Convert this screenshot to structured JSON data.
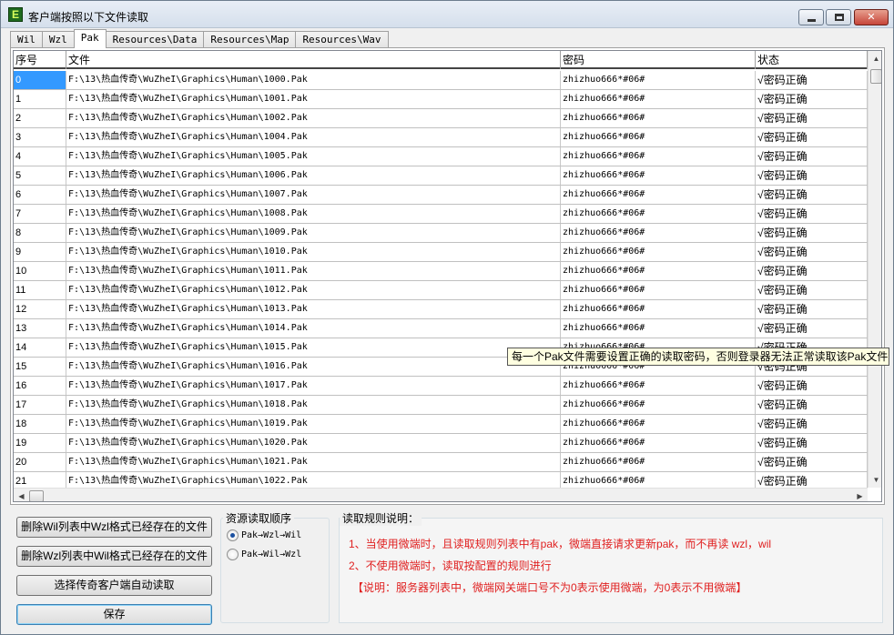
{
  "window": {
    "title": "客户端按照以下文件读取",
    "icon_letter": "E"
  },
  "tabs": [
    "Wil",
    "Wzl",
    "Pak",
    "Resources\\Data",
    "Resources\\Map",
    "Resources\\Wav"
  ],
  "active_tab": "Pak",
  "table": {
    "headers": [
      "序号",
      "文件",
      "密码",
      "状态"
    ],
    "rows": [
      {
        "idx": "0",
        "file": "F:\\13\\热血传奇\\WuZheI\\Graphics\\Human\\1000.Pak",
        "pwd": "zhizhuo666*#06#",
        "status": "√密码正确"
      },
      {
        "idx": "1",
        "file": "F:\\13\\热血传奇\\WuZheI\\Graphics\\Human\\1001.Pak",
        "pwd": "zhizhuo666*#06#",
        "status": "√密码正确"
      },
      {
        "idx": "2",
        "file": "F:\\13\\热血传奇\\WuZheI\\Graphics\\Human\\1002.Pak",
        "pwd": "zhizhuo666*#06#",
        "status": "√密码正确"
      },
      {
        "idx": "3",
        "file": "F:\\13\\热血传奇\\WuZheI\\Graphics\\Human\\1004.Pak",
        "pwd": "zhizhuo666*#06#",
        "status": "√密码正确"
      },
      {
        "idx": "4",
        "file": "F:\\13\\热血传奇\\WuZheI\\Graphics\\Human\\1005.Pak",
        "pwd": "zhizhuo666*#06#",
        "status": "√密码正确"
      },
      {
        "idx": "5",
        "file": "F:\\13\\热血传奇\\WuZheI\\Graphics\\Human\\1006.Pak",
        "pwd": "zhizhuo666*#06#",
        "status": "√密码正确"
      },
      {
        "idx": "6",
        "file": "F:\\13\\热血传奇\\WuZheI\\Graphics\\Human\\1007.Pak",
        "pwd": "zhizhuo666*#06#",
        "status": "√密码正确"
      },
      {
        "idx": "7",
        "file": "F:\\13\\热血传奇\\WuZheI\\Graphics\\Human\\1008.Pak",
        "pwd": "zhizhuo666*#06#",
        "status": "√密码正确"
      },
      {
        "idx": "8",
        "file": "F:\\13\\热血传奇\\WuZheI\\Graphics\\Human\\1009.Pak",
        "pwd": "zhizhuo666*#06#",
        "status": "√密码正确"
      },
      {
        "idx": "9",
        "file": "F:\\13\\热血传奇\\WuZheI\\Graphics\\Human\\1010.Pak",
        "pwd": "zhizhuo666*#06#",
        "status": "√密码正确"
      },
      {
        "idx": "10",
        "file": "F:\\13\\热血传奇\\WuZheI\\Graphics\\Human\\1011.Pak",
        "pwd": "zhizhuo666*#06#",
        "status": "√密码正确"
      },
      {
        "idx": "11",
        "file": "F:\\13\\热血传奇\\WuZheI\\Graphics\\Human\\1012.Pak",
        "pwd": "zhizhuo666*#06#",
        "status": "√密码正确"
      },
      {
        "idx": "12",
        "file": "F:\\13\\热血传奇\\WuZheI\\Graphics\\Human\\1013.Pak",
        "pwd": "zhizhuo666*#06#",
        "status": "√密码正确"
      },
      {
        "idx": "13",
        "file": "F:\\13\\热血传奇\\WuZheI\\Graphics\\Human\\1014.Pak",
        "pwd": "zhizhuo666*#06#",
        "status": "√密码正确"
      },
      {
        "idx": "14",
        "file": "F:\\13\\热血传奇\\WuZheI\\Graphics\\Human\\1015.Pak",
        "pwd": "zhizhuo666*#06#",
        "status": "√密码正确"
      },
      {
        "idx": "15",
        "file": "F:\\13\\热血传奇\\WuZheI\\Graphics\\Human\\1016.Pak",
        "pwd": "zhizhuo666*#06#",
        "status": "√密码正确"
      },
      {
        "idx": "16",
        "file": "F:\\13\\热血传奇\\WuZheI\\Graphics\\Human\\1017.Pak",
        "pwd": "zhizhuo666*#06#",
        "status": "√密码正确"
      },
      {
        "idx": "17",
        "file": "F:\\13\\热血传奇\\WuZheI\\Graphics\\Human\\1018.Pak",
        "pwd": "zhizhuo666*#06#",
        "status": "√密码正确"
      },
      {
        "idx": "18",
        "file": "F:\\13\\热血传奇\\WuZheI\\Graphics\\Human\\1019.Pak",
        "pwd": "zhizhuo666*#06#",
        "status": "√密码正确"
      },
      {
        "idx": "19",
        "file": "F:\\13\\热血传奇\\WuZheI\\Graphics\\Human\\1020.Pak",
        "pwd": "zhizhuo666*#06#",
        "status": "√密码正确"
      },
      {
        "idx": "20",
        "file": "F:\\13\\热血传奇\\WuZheI\\Graphics\\Human\\1021.Pak",
        "pwd": "zhizhuo666*#06#",
        "status": "√密码正确"
      },
      {
        "idx": "21",
        "file": "F:\\13\\热血传奇\\WuZheI\\Graphics\\Human\\1022.Pak",
        "pwd": "zhizhuo666*#06#",
        "status": "√密码正确"
      }
    ]
  },
  "tooltip": "每一个Pak文件需要设置正确的读取密码，否则登录器无法正常读取该Pak文件",
  "buttons": {
    "delete_wil": "删除Wil列表中Wzl格式已经存在的文件",
    "delete_wzl": "删除Wzl列表中Wil格式已经存在的文件",
    "auto_read": "选择传奇客户端自动读取",
    "save": "保存"
  },
  "order_group": {
    "title": "资源读取顺序",
    "options": [
      "Pak→Wzl→Wil",
      "Pak→Wil→Wzl"
    ],
    "selected_index": 0
  },
  "rules": {
    "title": "读取规则说明：",
    "line1": "1、当使用微端时，且读取规则列表中有pak，微端直接请求更新pak，而不再读 wzl，wil",
    "line2": "2、不使用微端时，读取按配置的规则进行",
    "line3": "【说明：服务器列表中，微端网关端口号不为0表示使用微端，为0表示不用微端】"
  },
  "colors": {
    "selection": "#3399ff",
    "rule_text": "#e02020",
    "tooltip_bg": "#ffffe1"
  }
}
